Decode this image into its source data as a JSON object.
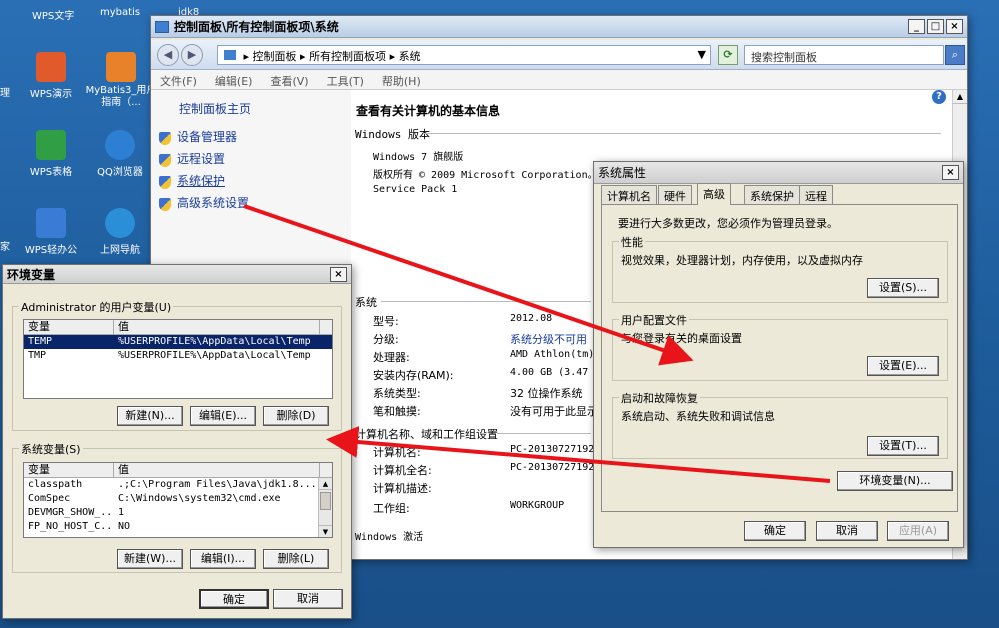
{
  "desktop": {
    "top_labels": [
      "WPS文字",
      "mybatis",
      "jdk8"
    ],
    "icons": [
      {
        "label": "WPS演示",
        "color": "#e15a2b"
      },
      {
        "label": "MyBatis3_用户指南（...",
        "color": "#e8822a"
      },
      {
        "label": "WPS表格",
        "color": "#2f9e44"
      },
      {
        "label": "QQ浏览器",
        "color": "#2d7fd3"
      },
      {
        "label": "WPS轻办公",
        "color": "#3a7bd5"
      },
      {
        "label": "上网导航",
        "color": "#2a8fd6"
      }
    ],
    "edge_labels": [
      "理",
      "家"
    ]
  },
  "control_panel": {
    "title": "控制面板\\所有控制面板项\\系统",
    "breadcrumb": [
      "控制面板",
      "所有控制面板项",
      "系统"
    ],
    "search_placeholder": "搜索控制面板",
    "menu": [
      "文件(F)",
      "编辑(E)",
      "查看(V)",
      "工具(T)",
      "帮助(H)"
    ],
    "side_home": "控制面板主页",
    "side_links": [
      "设备管理器",
      "远程设置",
      "系统保护",
      "高级系统设置"
    ],
    "main_title": "查看有关计算机的基本信息",
    "windows_edition": {
      "header": "Windows 版本",
      "lines": [
        "Windows 7 旗舰版",
        "版权所有 © 2009 Microsoft Corporation。保",
        "Service Pack 1"
      ]
    },
    "system": {
      "header": "系统",
      "rows": [
        {
          "label": "型号:",
          "value": "2012.08"
        },
        {
          "label": "分级:",
          "value": "系统分级不可用"
        },
        {
          "label": "处理器:",
          "value": "AMD Athlon(tm)"
        },
        {
          "label": "安装内存(RAM):",
          "value": "4.00 GB (3.47 G"
        },
        {
          "label": "系统类型:",
          "value": "32 位操作系统"
        },
        {
          "label": "笔和触摸:",
          "value": "没有可用于此显示"
        }
      ]
    },
    "computer": {
      "header": "计算机名称、域和工作组设置",
      "rows": [
        {
          "label": "计算机名:",
          "value": "PC-20130727192"
        },
        {
          "label": "计算机全名:",
          "value": "PC-20130727192"
        },
        {
          "label": "计算机描述:",
          "value": ""
        },
        {
          "label": "工作组:",
          "value": "WORKGROUP"
        }
      ]
    },
    "activation_header": "Windows 激活"
  },
  "system_properties": {
    "title": "系统属性",
    "tabs": [
      "计算机名",
      "硬件",
      "高级",
      "系统保护",
      "远程"
    ],
    "admin_note": "要进行大多数更改，您必须作为管理员登录。",
    "performance": {
      "title": "性能",
      "desc": "视觉效果，处理器计划，内存使用，以及虚拟内存",
      "button": "设置(S)..."
    },
    "profiles": {
      "title": "用户配置文件",
      "desc": "与您登录有关的桌面设置",
      "button": "设置(E)..."
    },
    "startup": {
      "title": "启动和故障恢复",
      "desc": "系统启动、系统失败和调试信息",
      "button": "设置(T)..."
    },
    "env_button": "环境变量(N)...",
    "ok": "确定",
    "cancel": "取消",
    "apply": "应用(A)"
  },
  "env_vars": {
    "title": "环境变量",
    "user_group": "Administrator 的用户变量(U)",
    "columns": [
      "变量",
      "值"
    ],
    "user_rows": [
      {
        "name": "TEMP",
        "value": "%USERPROFILE%\\AppData\\Local\\Temp"
      },
      {
        "name": "TMP",
        "value": "%USERPROFILE%\\AppData\\Local\\Temp"
      }
    ],
    "user_buttons": [
      "新建(N)...",
      "编辑(E)...",
      "删除(D)"
    ],
    "system_group": "系统变量(S)",
    "system_rows": [
      {
        "name": "classpath",
        "value": ".;C:\\Program Files\\Java\\jdk1.8...."
      },
      {
        "name": "ComSpec",
        "value": "C:\\Windows\\system32\\cmd.exe"
      },
      {
        "name": "DEVMGR_SHOW_...",
        "value": "1"
      },
      {
        "name": "FP_NO_HOST_C...",
        "value": "NO"
      }
    ],
    "system_buttons": [
      "新建(W)...",
      "编辑(I)...",
      "删除(L)"
    ],
    "ok": "确定",
    "cancel": "取消"
  }
}
